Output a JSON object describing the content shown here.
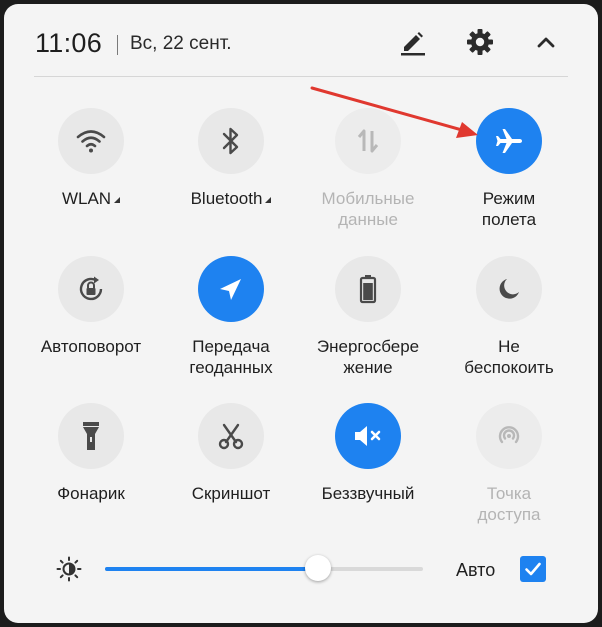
{
  "header": {
    "time": "11:06",
    "date": "Вс, 22 сент."
  },
  "tiles": [
    {
      "label_1": "WLAN",
      "label_2": "",
      "icon": "wifi-icon",
      "state": "off"
    },
    {
      "label_1": "Bluetooth",
      "label_2": "",
      "icon": "bluetooth-icon",
      "state": "off"
    },
    {
      "label_1": "Мобильные",
      "label_2": "данные",
      "icon": "mobile-data-icon",
      "state": "disabled"
    },
    {
      "label_1": "Режим",
      "label_2": "полета",
      "icon": "airplane-icon",
      "state": "on"
    },
    {
      "label_1": "Автоповорот",
      "label_2": "",
      "icon": "auto-rotate-icon",
      "state": "off"
    },
    {
      "label_1": "Передача",
      "label_2": "геоданных",
      "icon": "location-icon",
      "state": "on"
    },
    {
      "label_1": "Энергосбере",
      "label_2": "жение",
      "icon": "battery-icon",
      "state": "off"
    },
    {
      "label_1": "Не",
      "label_2": "беспокоить",
      "icon": "moon-icon",
      "state": "off"
    },
    {
      "label_1": "Фонарик",
      "label_2": "",
      "icon": "flashlight-icon",
      "state": "off"
    },
    {
      "label_1": "Скриншот",
      "label_2": "",
      "icon": "scissors-icon",
      "state": "off"
    },
    {
      "label_1": "Беззвучный",
      "label_2": "",
      "icon": "mute-icon",
      "state": "on"
    },
    {
      "label_1": "Точка",
      "label_2": "доступа",
      "icon": "hotspot-icon",
      "state": "disabled"
    }
  ],
  "brightness": {
    "level": 0.67,
    "auto_label": "Авто",
    "auto_checked": true
  },
  "colors": {
    "accent": "#1e82f0",
    "annotation_arrow": "#e0382f"
  }
}
